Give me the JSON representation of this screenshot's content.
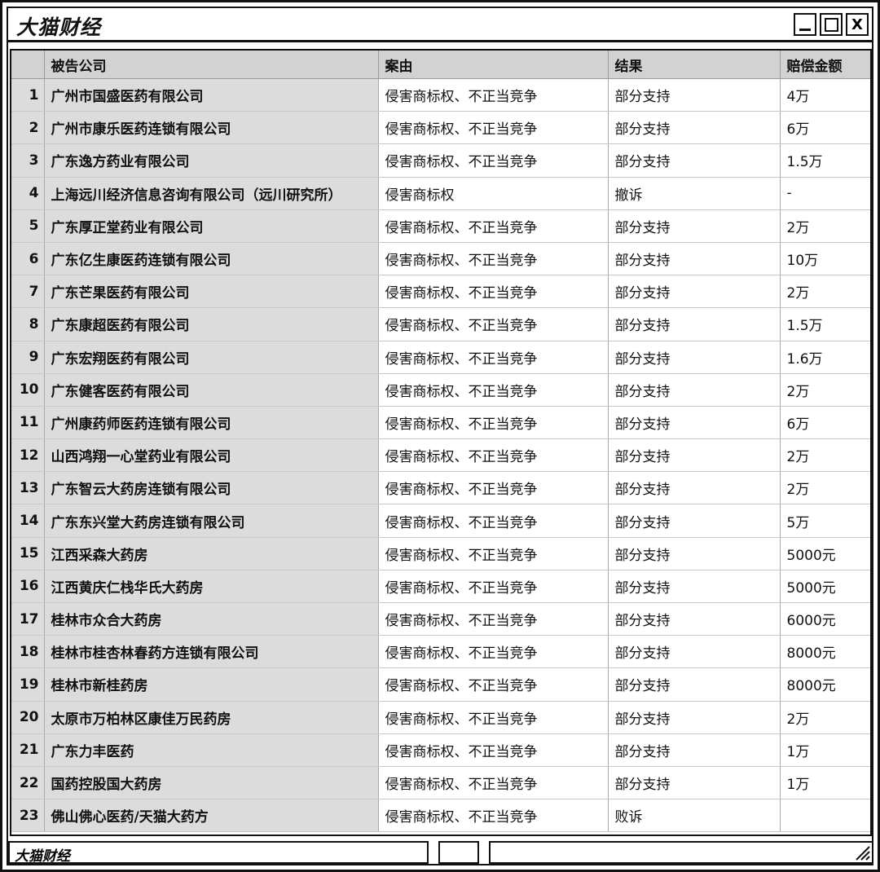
{
  "window": {
    "title": "大猫财经",
    "status_text": "大猫财经",
    "close_label": "X"
  },
  "table": {
    "columns": [
      "",
      "被告公司",
      "案由",
      "结果",
      "赔偿金额"
    ],
    "rows": [
      {
        "no": "1",
        "company": "广州市国盛医药有限公司",
        "cause": "侵害商标权、不正当竞争",
        "result": "部分支持",
        "amount": "4万"
      },
      {
        "no": "2",
        "company": "广州市康乐医药连锁有限公司",
        "cause": "侵害商标权、不正当竞争",
        "result": "部分支持",
        "amount": "6万"
      },
      {
        "no": "3",
        "company": "广东逸方药业有限公司",
        "cause": "侵害商标权、不正当竞争",
        "result": "部分支持",
        "amount": "1.5万"
      },
      {
        "no": "4",
        "company": "上海远川经济信息咨询有限公司（远川研究所）",
        "cause": "侵害商标权",
        "result": "撤诉",
        "amount": "-"
      },
      {
        "no": "5",
        "company": "广东厚正堂药业有限公司",
        "cause": "侵害商标权、不正当竞争",
        "result": "部分支持",
        "amount": "2万"
      },
      {
        "no": "6",
        "company": "广东亿生康医药连锁有限公司",
        "cause": "侵害商标权、不正当竞争",
        "result": "部分支持",
        "amount": "10万"
      },
      {
        "no": "7",
        "company": "广东芒果医药有限公司",
        "cause": "侵害商标权、不正当竞争",
        "result": "部分支持",
        "amount": "2万"
      },
      {
        "no": "8",
        "company": "广东康超医药有限公司",
        "cause": "侵害商标权、不正当竞争",
        "result": "部分支持",
        "amount": "1.5万"
      },
      {
        "no": "9",
        "company": "广东宏翔医药有限公司",
        "cause": "侵害商标权、不正当竞争",
        "result": "部分支持",
        "amount": "1.6万"
      },
      {
        "no": "10",
        "company": "广东健客医药有限公司",
        "cause": "侵害商标权、不正当竞争",
        "result": "部分支持",
        "amount": "2万"
      },
      {
        "no": "11",
        "company": "广州康药师医药连锁有限公司",
        "cause": "侵害商标权、不正当竞争",
        "result": "部分支持",
        "amount": "6万"
      },
      {
        "no": "12",
        "company": "山西鸿翔一心堂药业有限公司",
        "cause": "侵害商标权、不正当竞争",
        "result": "部分支持",
        "amount": "2万"
      },
      {
        "no": "13",
        "company": "广东智云大药房连锁有限公司",
        "cause": "侵害商标权、不正当竞争",
        "result": "部分支持",
        "amount": "2万"
      },
      {
        "no": "14",
        "company": "广东东兴堂大药房连锁有限公司",
        "cause": "侵害商标权、不正当竞争",
        "result": "部分支持",
        "amount": "5万"
      },
      {
        "no": "15",
        "company": "江西采森大药房",
        "cause": "侵害商标权、不正当竞争",
        "result": "部分支持",
        "amount": "5000元"
      },
      {
        "no": "16",
        "company": "江西黄庆仁栈华氏大药房",
        "cause": "侵害商标权、不正当竞争",
        "result": "部分支持",
        "amount": "5000元"
      },
      {
        "no": "17",
        "company": "桂林市众合大药房",
        "cause": "侵害商标权、不正当竞争",
        "result": "部分支持",
        "amount": "6000元"
      },
      {
        "no": "18",
        "company": "桂林市桂杏林春药方连锁有限公司",
        "cause": "侵害商标权、不正当竞争",
        "result": "部分支持",
        "amount": "8000元"
      },
      {
        "no": "19",
        "company": "桂林市新桂药房",
        "cause": "侵害商标权、不正当竞争",
        "result": "部分支持",
        "amount": "8000元"
      },
      {
        "no": "20",
        "company": "太原市万柏林区康佳万民药房",
        "cause": "侵害商标权、不正当竞争",
        "result": "部分支持",
        "amount": "2万"
      },
      {
        "no": "21",
        "company": "广东力丰医药",
        "cause": "侵害商标权、不正当竞争",
        "result": "部分支持",
        "amount": "1万"
      },
      {
        "no": "22",
        "company": "国药控股国大药房",
        "cause": "侵害商标权、不正当竞争",
        "result": "部分支持",
        "amount": "1万"
      },
      {
        "no": "23",
        "company": "佛山佛心医药/天猫大药方",
        "cause": "侵害商标权、不正当竞争",
        "result": "败诉",
        "amount": ""
      }
    ]
  }
}
